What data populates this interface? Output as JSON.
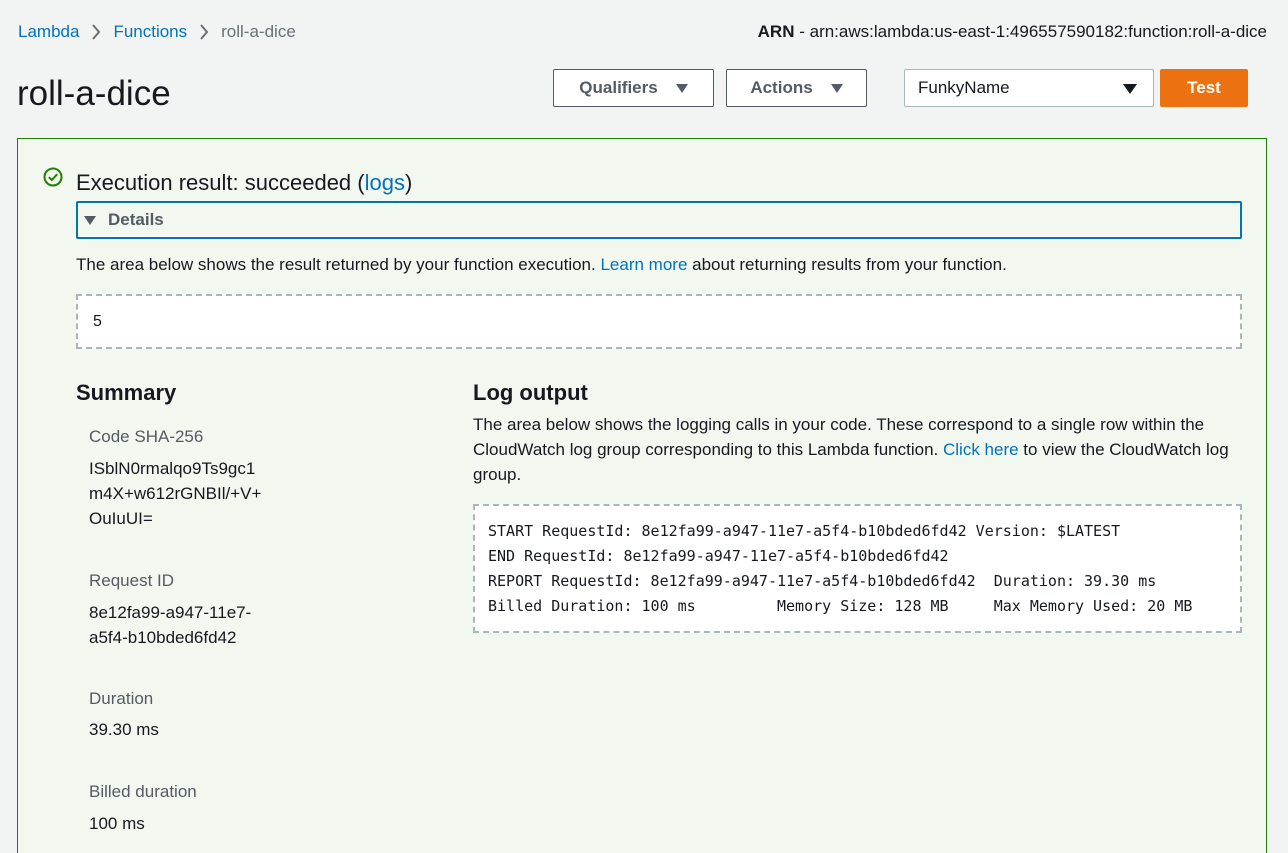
{
  "breadcrumb": {
    "items": [
      "Lambda",
      "Functions",
      "roll-a-dice"
    ]
  },
  "arn": {
    "key": "ARN",
    "separator": " - ",
    "value": "arn:aws:lambda:us-east-1:496557590182:function:roll-a-dice"
  },
  "page": {
    "title": "roll-a-dice"
  },
  "toolbar": {
    "qualifiers_label": "Qualifiers",
    "actions_label": "Actions",
    "test_event_selected": "FunkyName",
    "test_label": "Test"
  },
  "result": {
    "heading_prefix": "Execution result: succeeded (",
    "heading_link": "logs",
    "heading_suffix": ")",
    "details_label": "Details",
    "desc_prefix": "The area below shows the result returned by your function execution. ",
    "desc_link": "Learn more",
    "desc_suffix": " about returning results from your function.",
    "value": "5"
  },
  "summary": {
    "title": "Summary",
    "code_sha_label": "Code SHA-256",
    "code_sha_lines": [
      "ISblN0rmalqo9Ts9gc1",
      "m4X+w612rGNBIl/+V+",
      "OuIuUI="
    ],
    "request_id_label": "Request ID",
    "request_id_lines": [
      "8e12fa99-a947-11e7-",
      "a5f4-b10bded6fd42"
    ],
    "duration_label": "Duration",
    "duration_value": "39.30 ms",
    "billed_label": "Billed duration",
    "billed_value": "100 ms"
  },
  "log": {
    "title": "Log output",
    "desc_prefix": "The area below shows the logging calls in your code. These correspond to a single row within the CloudWatch log group corresponding to this Lambda function. ",
    "desc_link": "Click here",
    "desc_suffix": " to view the CloudWatch log group.",
    "lines": [
      "START RequestId: 8e12fa99-a947-11e7-a5f4-b10bded6fd42 Version: $LATEST",
      "END RequestId: 8e12fa99-a947-11e7-a5f4-b10bded6fd42",
      "REPORT RequestId: 8e12fa99-a947-11e7-a5f4-b10bded6fd42  Duration: 39.30 ms",
      "Billed Duration: 100 ms         Memory Size: 128 MB     Max Memory Used: 20 MB"
    ]
  },
  "colors": {
    "link": "#0073bb",
    "success": "#1d8102",
    "primary_button": "#ec7211",
    "panel_bg": "#f2f8f0"
  }
}
